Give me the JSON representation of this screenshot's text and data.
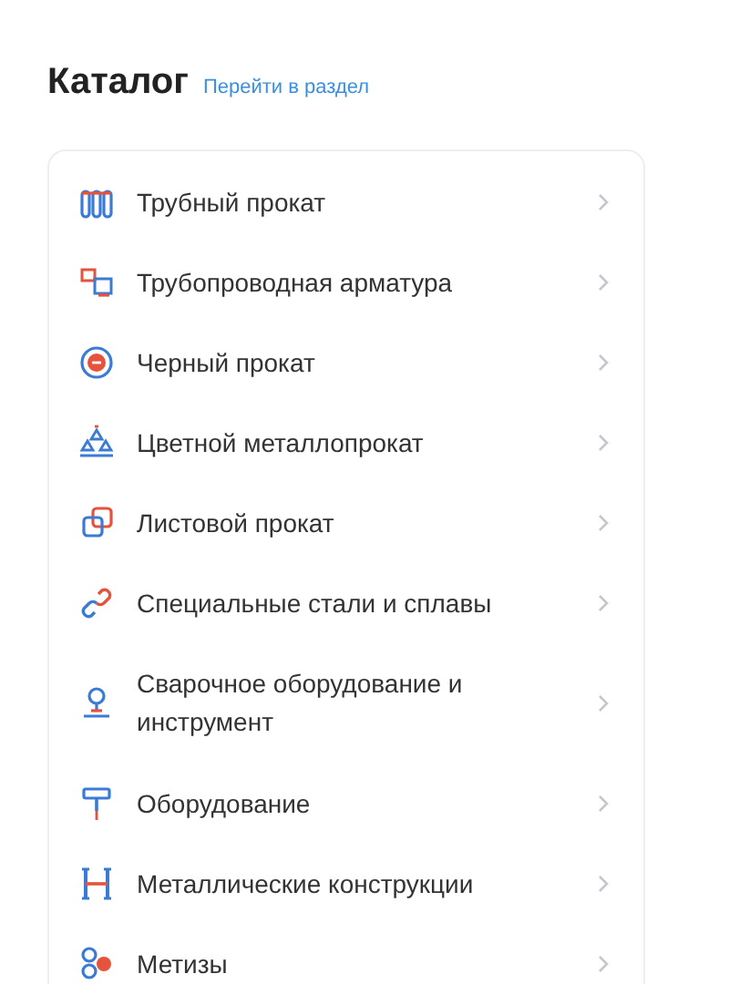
{
  "header": {
    "title": "Каталог",
    "link": "Перейти в раздел"
  },
  "catalog": [
    {
      "label": "Трубный прокат"
    },
    {
      "label": "Трубопроводная арматура"
    },
    {
      "label": "Черный прокат"
    },
    {
      "label": "Цветной металлопрокат"
    },
    {
      "label": "Листовой прокат"
    },
    {
      "label": "Специальные стали и сплавы"
    },
    {
      "label": "Сварочное оборудование и инструмент"
    },
    {
      "label": "Оборудование"
    },
    {
      "label": "Металлические конструкции"
    },
    {
      "label": "Метизы"
    }
  ]
}
